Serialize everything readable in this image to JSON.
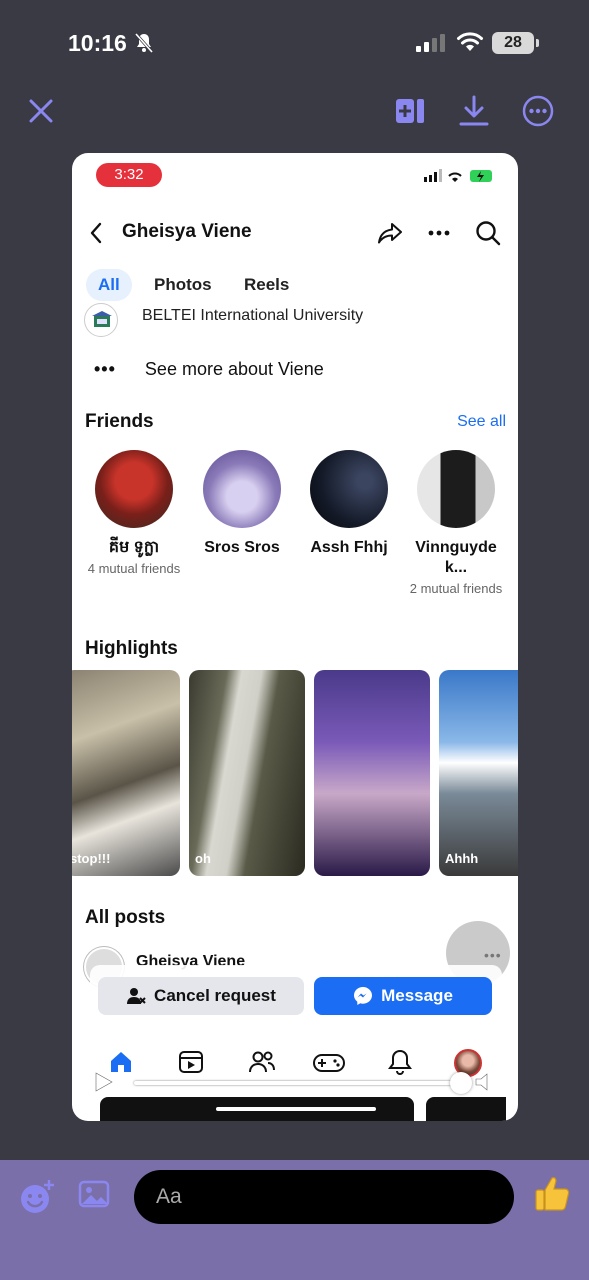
{
  "status_bar": {
    "time": "10:16",
    "battery": "28"
  },
  "embedded": {
    "status_time": "3:32",
    "profile_name": "Gheisya Viene",
    "tabs": [
      {
        "label": "All",
        "active": true
      },
      {
        "label": "Photos",
        "active": false
      },
      {
        "label": "Reels",
        "active": false
      }
    ],
    "education": "BELTEI International University",
    "see_more": "See more about Viene",
    "friends": {
      "title": "Friends",
      "see_all": "See all",
      "items": [
        {
          "name": "គីម ទូក្លា",
          "mutual": "4 mutual friends"
        },
        {
          "name": "Sros Sros",
          "mutual": ""
        },
        {
          "name": "Assh Fhhj",
          "mutual": ""
        },
        {
          "name": "Vinnguyde k...",
          "mutual": "2 mutual friends"
        }
      ]
    },
    "highlights": {
      "title": "Highlights",
      "items": [
        {
          "label": "stop!!!"
        },
        {
          "label": "oh"
        },
        {
          "label": ""
        },
        {
          "label": "Ahhh"
        }
      ]
    },
    "all_posts": {
      "title": "All posts",
      "author": "Gheisya Viene"
    },
    "actions": {
      "cancel": "Cancel request",
      "message": "Message"
    }
  },
  "composer": {
    "placeholder": "Aa"
  },
  "colors": {
    "accent": "#1b6ef3",
    "composer_bg": "#7a6fa8",
    "viewer_icons": "#8b87f0"
  }
}
